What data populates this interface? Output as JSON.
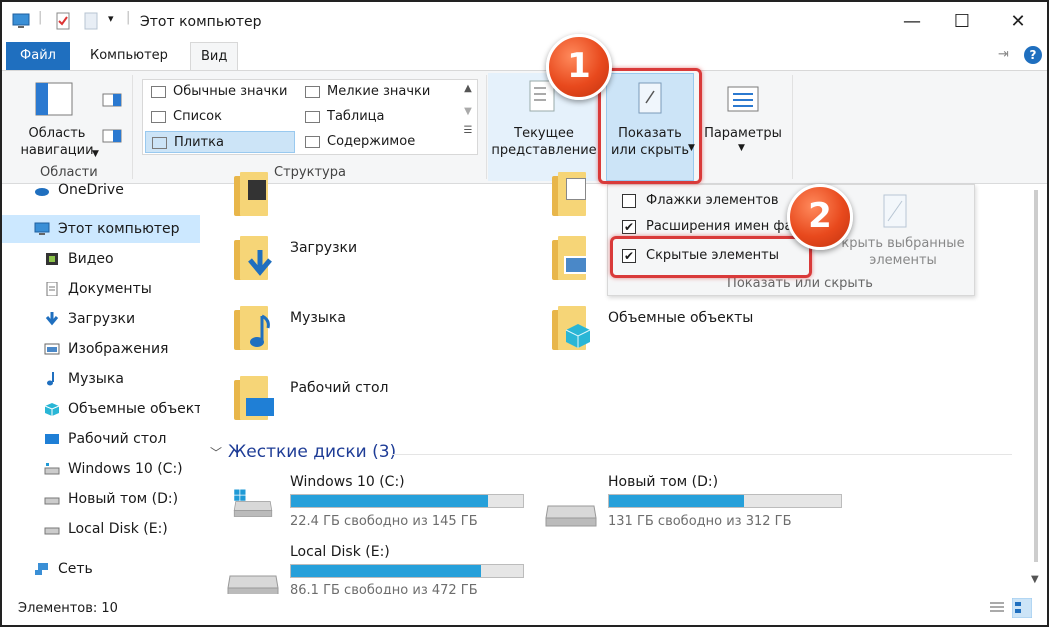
{
  "window": {
    "title": "Этот компьютер",
    "controls": {
      "minimize": "—",
      "maximize": "☐",
      "close": "✕"
    }
  },
  "menu": {
    "tabs": [
      "Файл",
      "Компьютер",
      "Вид"
    ],
    "pin": "⇥",
    "help": "?"
  },
  "ribbon": {
    "areas": {
      "nav_pane": "Область\nнавигации",
      "group_label": "Области"
    },
    "layout": {
      "items": [
        "Обычные значки",
        "Мелкие значки",
        "Список",
        "Таблица",
        "Плитка",
        "Содержимое"
      ],
      "selected": "Плитка",
      "group_label": "Структура"
    },
    "current_view": "Текущее\nпредставление",
    "show_hide": "Показать\nили скрыть",
    "options": "Параметры"
  },
  "popup": {
    "items": [
      {
        "label": "Флажки элементов",
        "checked": false
      },
      {
        "label": "Расширения имен фа",
        "checked": true
      },
      {
        "label": "Скрытые элементы",
        "checked": true
      }
    ],
    "hide_selected": "крыть выбранные\nэлементы",
    "group_label": "Показать или скрыть"
  },
  "sidebar": {
    "items": [
      {
        "label": "OneDrive",
        "icon": "cloud-icon"
      },
      {
        "label": "Этот компьютер",
        "icon": "computer-icon",
        "selected": true
      },
      {
        "label": "Видео",
        "icon": "video-icon"
      },
      {
        "label": "Документы",
        "icon": "document-icon"
      },
      {
        "label": "Загрузки",
        "icon": "download-icon"
      },
      {
        "label": "Изображения",
        "icon": "image-icon"
      },
      {
        "label": "Музыка",
        "icon": "music-icon"
      },
      {
        "label": "Объемные объекты",
        "icon": "cube-icon"
      },
      {
        "label": "Рабочий стол",
        "icon": "desktop-icon"
      },
      {
        "label": "Windows 10 (C:)",
        "icon": "drive-icon"
      },
      {
        "label": "Новый том (D:)",
        "icon": "drive-icon"
      },
      {
        "label": "Local Disk (E:)",
        "icon": "drive-icon"
      },
      {
        "label": "Сеть",
        "icon": "network-icon"
      }
    ]
  },
  "folders": [
    {
      "label": "Загрузки"
    },
    {
      "label": "Музыка"
    },
    {
      "label": "Объемные объекты"
    },
    {
      "label": "Рабочий стол"
    }
  ],
  "drives_section": {
    "title": "Жесткие диски (3)",
    "drives": [
      {
        "name": "Windows 10 (C:)",
        "free": "22.4 ГБ свободно из 145 ГБ",
        "used_fraction": 0.85
      },
      {
        "name": "Новый том (D:)",
        "free": "131 ГБ свободно из 312 ГБ",
        "used_fraction": 0.58
      },
      {
        "name": "Local Disk (E:)",
        "free": "86.1 ГБ свободно из 472 ГБ",
        "used_fraction": 0.82
      }
    ]
  },
  "status": {
    "items_count": "Элементов: 10"
  },
  "callouts": [
    "1",
    "2"
  ]
}
